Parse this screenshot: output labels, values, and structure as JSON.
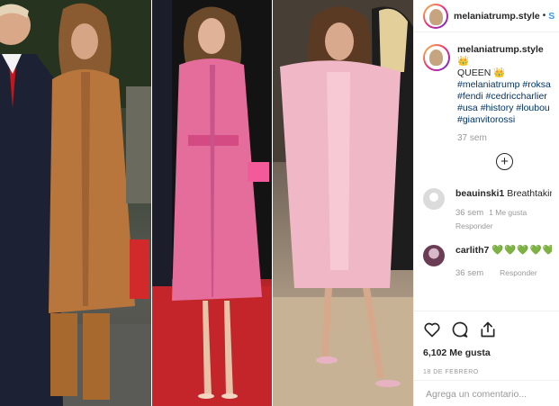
{
  "post": {
    "username": "melaniatrump.style",
    "follow_label": "S",
    "caption_username": "melaniatrump.style",
    "caption_crown": "👑",
    "caption_text": "QUEEN",
    "caption_crown2": "👑",
    "hashtags": [
      "#melaniatrump",
      "#roksa",
      "#fendi",
      "#cedriccharlier",
      "#usa",
      "#history",
      "#loubou",
      "#gianvitorossi"
    ],
    "caption_time": "37 sem",
    "likes": "6,102 Me gusta",
    "date": "18 DE FEBRERO",
    "add_comment_placeholder": "Agrega un comentario..."
  },
  "comments": [
    {
      "username": "beauinski1",
      "text": "Breathtakin",
      "time": "36 sem",
      "likes": "1 Me gusta",
      "reply": "Responder"
    },
    {
      "username": "carlith7",
      "text": "💚💚💚💚💚",
      "time": "36 sem",
      "reply": "Responder"
    }
  ],
  "icons": {
    "like": "heart-icon",
    "comment": "comment-icon",
    "share": "share-icon",
    "more": "plus-circle-icon"
  }
}
